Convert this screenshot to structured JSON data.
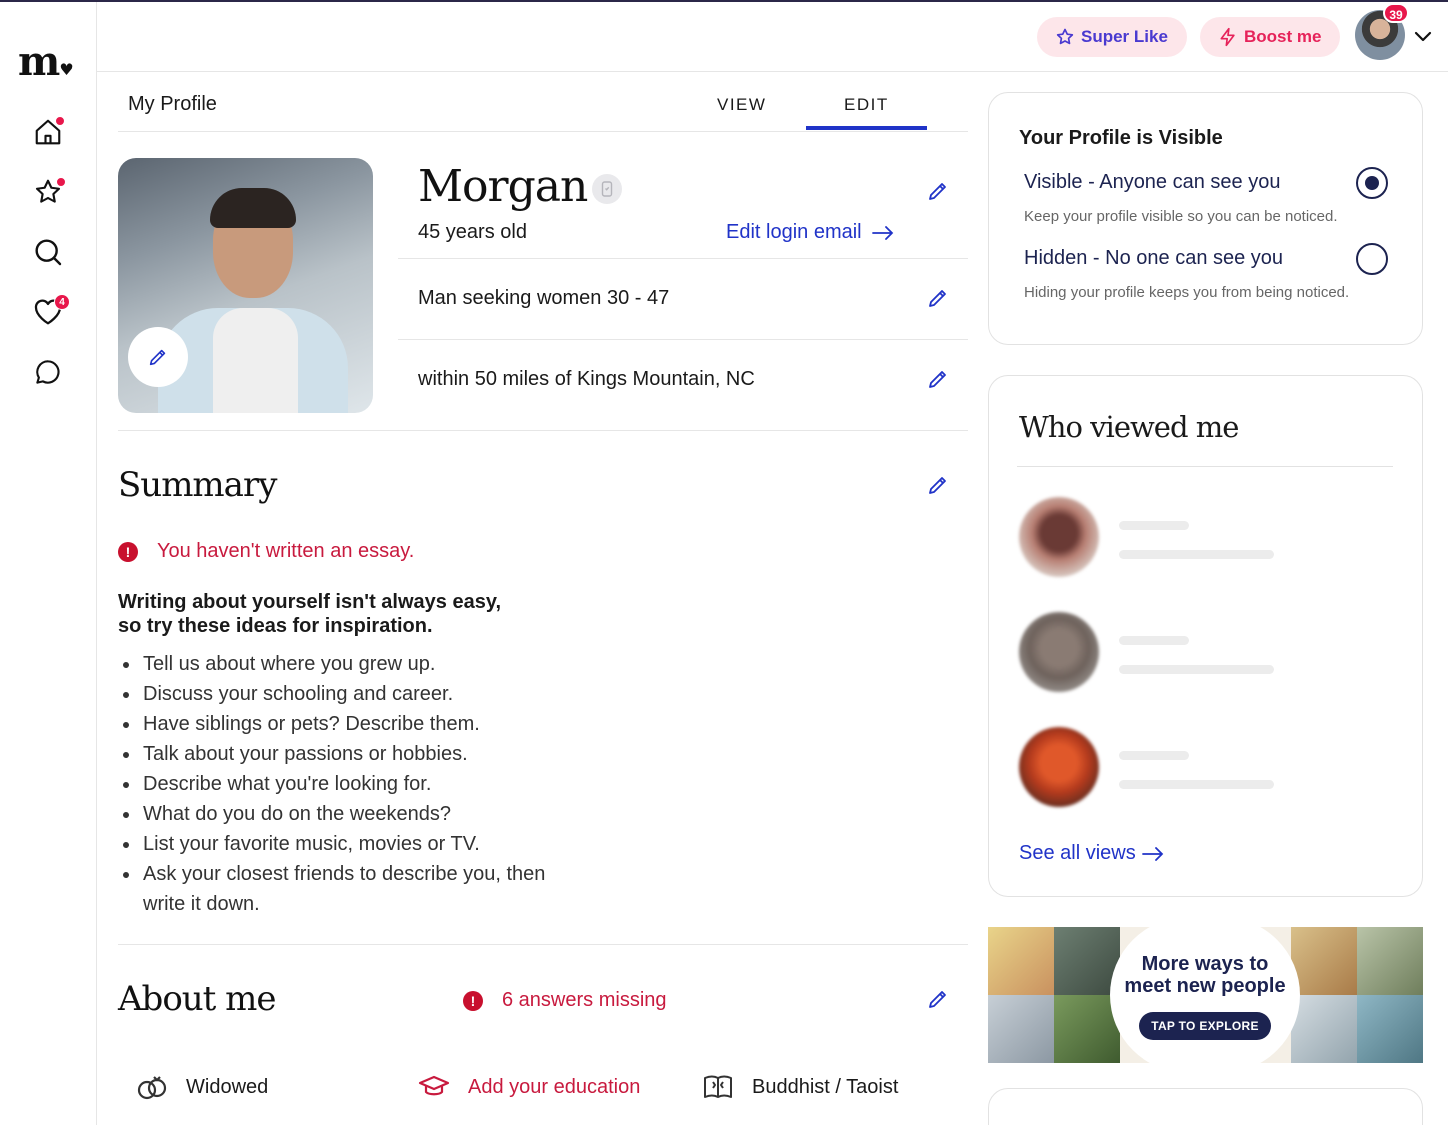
{
  "logo": {
    "text": "m",
    "heart": "♥"
  },
  "nav": [
    {
      "name": "home-icon",
      "dot": true
    },
    {
      "name": "star-icon",
      "dot": true
    },
    {
      "name": "search-icon",
      "dot": false
    },
    {
      "name": "heart-icon",
      "count": "4"
    },
    {
      "name": "chat-icon",
      "dot": false
    }
  ],
  "header": {
    "super_like": "Super Like",
    "boost": "Boost me",
    "notifications": "39"
  },
  "subnav": {
    "title": "My Profile",
    "tabs": [
      "VIEW",
      "EDIT"
    ],
    "active": "EDIT"
  },
  "profile": {
    "name": "Morgan",
    "age": "45 years old",
    "edit_email": "Edit login email",
    "seeking": "Man seeking women 30 - 47",
    "location": "within 50 miles of Kings Mountain, NC"
  },
  "summary": {
    "title": "Summary",
    "warning": "You haven't written an essay.",
    "inspire_line1": "Writing about yourself isn't always easy,",
    "inspire_line2": "so try these ideas for inspiration.",
    "tips": [
      "Tell us about where you grew up.",
      "Discuss your schooling and career.",
      "Have siblings or pets? Describe them.",
      "Talk about your passions or hobbies.",
      "Describe what you're looking for.",
      "What do you do on the weekends?",
      "List your favorite music, movies or TV.",
      "Ask your closest friends to describe you, then write it down."
    ]
  },
  "about": {
    "title": "About me",
    "missing": "6 answers missing",
    "items": [
      {
        "label": "Widowed",
        "icon": "rings-icon",
        "link": false
      },
      {
        "label": "Add your education",
        "icon": "graduation-cap-icon",
        "link": true
      },
      {
        "label": "Buddhist / Taoist",
        "icon": "book-icon",
        "link": false
      }
    ]
  },
  "visibility": {
    "title": "Your Profile is Visible",
    "visible_label": "Visible - Anyone can see you",
    "visible_desc": "Keep your profile visible so you can be noticed.",
    "hidden_label": "Hidden - No one can see you",
    "hidden_desc": "Hiding your profile keeps you from being noticed.",
    "selected": "visible"
  },
  "viewed": {
    "title": "Who viewed me",
    "see_all": "See all views"
  },
  "banner": {
    "line1": "More ways to",
    "line2": "meet new people",
    "button": "TAP TO EXPLORE"
  },
  "colors": {
    "accent_blue": "#2033c8",
    "alert_red": "#c81a3e",
    "navy": "#1c2350",
    "pink_bg": "#fde6ea"
  }
}
